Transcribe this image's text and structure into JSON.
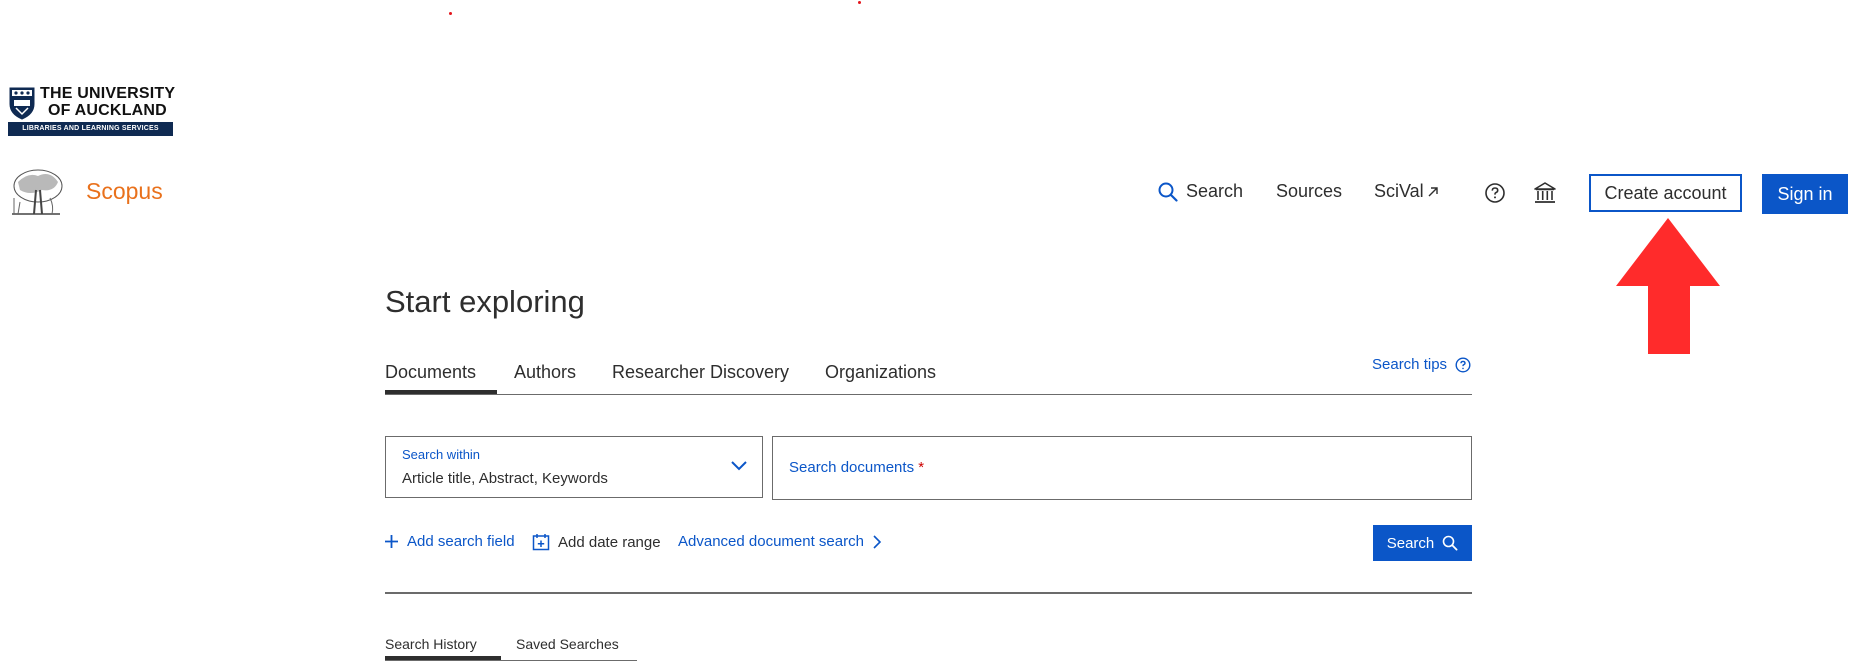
{
  "university": {
    "line1": "THE UNIVERSITY",
    "line2": "OF AUCKLAND",
    "subtitle": "LIBRARIES AND LEARNING SERVICES"
  },
  "brand": {
    "name": "Scopus"
  },
  "nav": {
    "search_label": "Search",
    "sources_label": "Sources",
    "scival_label": "SciVal",
    "create_account_label": "Create account",
    "sign_in_label": "Sign in"
  },
  "main": {
    "title": "Start exploring",
    "tabs": [
      {
        "label": "Documents"
      },
      {
        "label": "Authors"
      },
      {
        "label": "Researcher Discovery"
      },
      {
        "label": "Organizations"
      }
    ],
    "search_tips": "Search tips",
    "search_within": {
      "label": "Search within",
      "value": "Article title, Abstract, Keywords"
    },
    "search_documents": {
      "placeholder": "Search documents",
      "required_mark": "*"
    },
    "add_search_field": "Add search field",
    "add_date_range": "Add date range",
    "advanced_search": "Advanced document search",
    "search_button": "Search"
  },
  "history": {
    "tabs": [
      {
        "label": "Search History"
      },
      {
        "label": "Saved Searches"
      }
    ]
  },
  "colors": {
    "accent_blue": "#0b56c8",
    "scopus_orange": "#e9711c",
    "annotation_red": "#ff2b2b"
  }
}
